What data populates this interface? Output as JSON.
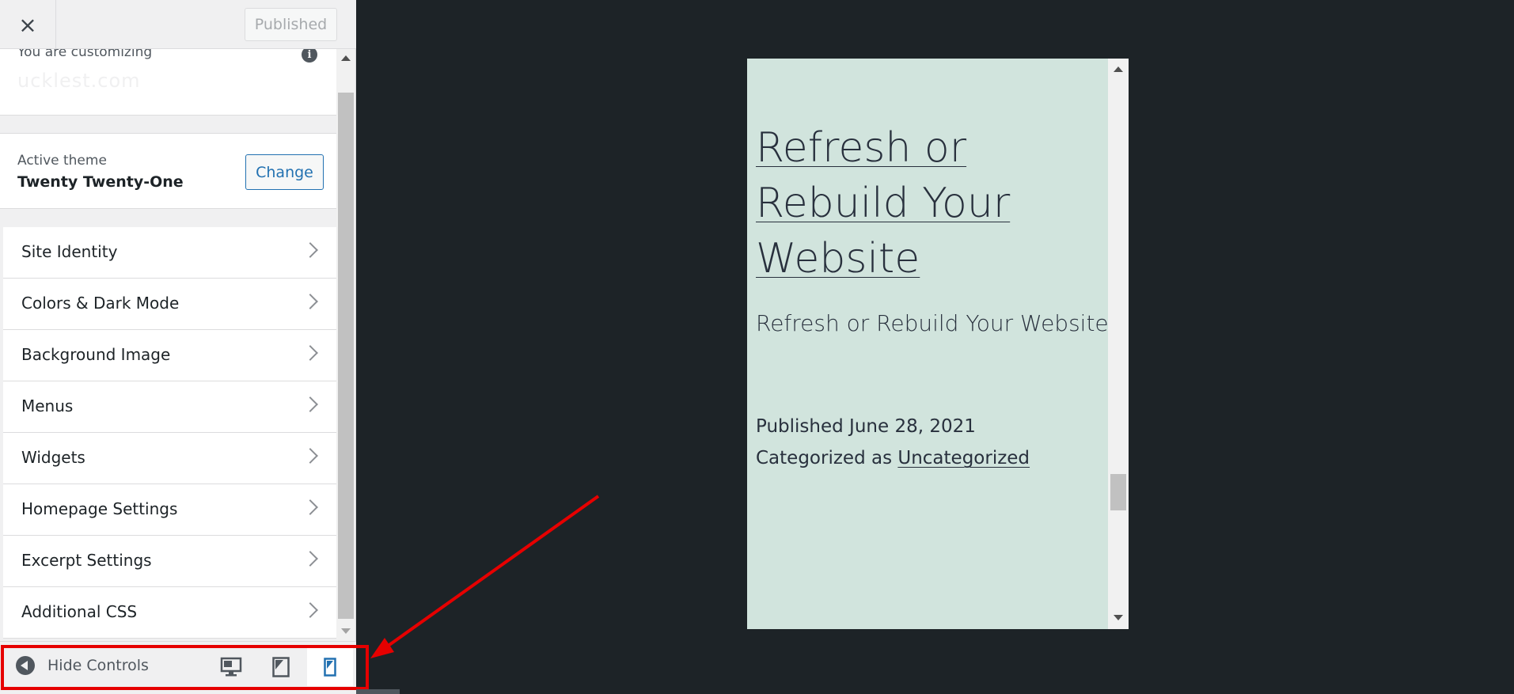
{
  "header": {
    "close_symbol": "×",
    "publish_label": "Published"
  },
  "info": {
    "customizing_label": "You are customizing",
    "site_name": "  ucklest.com"
  },
  "theme": {
    "label": "Active theme",
    "name": "Twenty Twenty-One",
    "change_label": "Change"
  },
  "panels": [
    {
      "label": "Site Identity"
    },
    {
      "label": "Colors & Dark Mode"
    },
    {
      "label": "Background Image"
    },
    {
      "label": "Menus"
    },
    {
      "label": "Widgets"
    },
    {
      "label": "Homepage Settings"
    },
    {
      "label": "Excerpt Settings"
    },
    {
      "label": "Additional CSS"
    }
  ],
  "footer": {
    "hide_controls_label": "Hide Controls",
    "devices": [
      {
        "name": "desktop",
        "active": false
      },
      {
        "name": "tablet",
        "active": false
      },
      {
        "name": "mobile",
        "active": true
      }
    ]
  },
  "preview": {
    "title_lines": [
      "Refresh or",
      "Rebuild Your",
      "Website"
    ],
    "subtitle": "Refresh or Rebuild Your Website",
    "published": "Published June 28, 2021",
    "categorized_prefix": "Categorized as ",
    "category": "Uncategorized"
  },
  "colors": {
    "accent": "#2271b1",
    "preview_bg": "#d1e4dd",
    "highlight": "#e60000",
    "canvas_bg": "#1d2327"
  }
}
